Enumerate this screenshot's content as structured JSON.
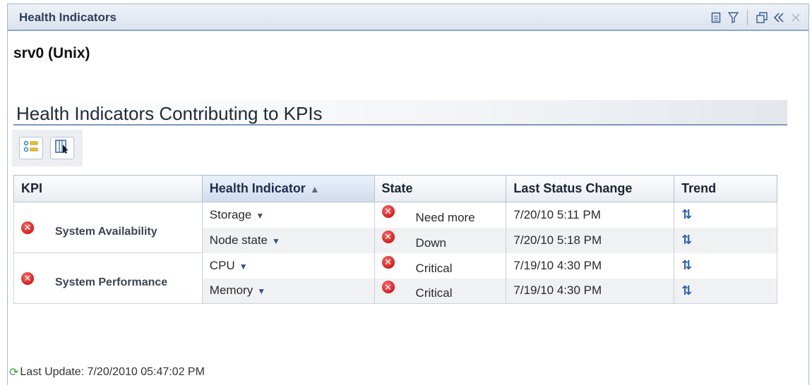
{
  "panel": {
    "title": "Health Indicators",
    "icons": [
      "page-icon",
      "filter-icon",
      "restore-window-icon",
      "collapse-left-icon",
      "close-icon"
    ]
  },
  "host": "srv0 (Unix)",
  "section_title": "Health Indicators Contributing to KPIs",
  "toolbar": {
    "buttons": [
      "select-items-icon",
      "column-chooser-icon"
    ]
  },
  "table": {
    "headers": {
      "kpi": "KPI",
      "health_indicator": "Health Indicator",
      "state": "State",
      "last_status_change": "Last Status Change",
      "trend": "Trend"
    },
    "sorted_column": "health_indicator",
    "kpis": [
      {
        "label": "System Availability",
        "status": "error",
        "rows": [
          {
            "indicator": "Storage",
            "state": "Need more",
            "last_change": "7/20/10 5:11 PM",
            "trend": "up-down-arrows-icon"
          },
          {
            "indicator": "Node state",
            "state": "Down",
            "last_change": "7/20/10 5:18 PM",
            "trend": "up-down-arrows-icon"
          }
        ]
      },
      {
        "label": "System Performance",
        "status": "error",
        "rows": [
          {
            "indicator": "CPU",
            "state": "Critical",
            "last_change": "7/19/10 4:30 PM",
            "trend": "up-down-arrows-icon"
          },
          {
            "indicator": "Memory",
            "state": "Critical",
            "last_change": "7/19/10 4:30 PM",
            "trend": "up-down-arrows-icon"
          }
        ]
      }
    ]
  },
  "footer": {
    "last_update": "Last Update: 7/20/2010 05:47:02 PM"
  },
  "colors": {
    "header_border": "#8fa6c4",
    "error_red": "#d0201f",
    "trend_blue": "#2f5fb5",
    "refresh_green": "#3aa23a"
  }
}
